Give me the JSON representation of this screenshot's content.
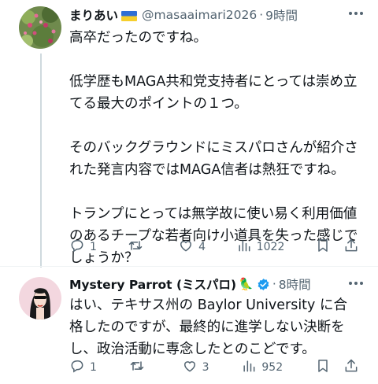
{
  "tweets": [
    {
      "display_name": "まりあい",
      "handle": "@masaaimari2026",
      "separator": "·",
      "time": "9時間",
      "body": [
        "高卒だったのですね。",
        "低学歴もMAGA共和党支持者にとっては崇め立\nてる最大のポイントの１つ。",
        "そのバックグラウンドにミスパロさんが紹介さ\nれた発言内容ではMAGA信者は熱狂ですね。",
        "トランプにとっては無学故に使い易く利用価値\nのあるチープな若者向け小道具を失った感じで\nしょうか？"
      ],
      "replies": "1",
      "retweets": "",
      "likes": "4",
      "views": "1022"
    },
    {
      "display_name": "Mystery Parrot (ミスパロ)",
      "handle": "",
      "separator": "·",
      "time": "8時間",
      "body": [
        "はい、テキサス州の Baylor University に合\n格したのですが、最終的に進学しない決断を\nし、政治活動に専念したとのこどです。"
      ],
      "replies": "1",
      "retweets": "",
      "likes": "3",
      "views": "952"
    }
  ],
  "icons": {
    "more": "more-horizontal-icon",
    "reply": "reply-icon",
    "retweet": "retweet-icon",
    "like": "heart-icon",
    "views": "bar-chart-icon",
    "bookmark": "bookmark-icon",
    "share": "share-icon",
    "flag": "ukraine-flag-icon",
    "parrot": "parrot-emoji-icon",
    "verified": "verified-badge-icon"
  },
  "colors": {
    "text": "#0f1419",
    "secondary": "#536471",
    "verified": "#1d9bf0",
    "divider": "#eff3f4"
  }
}
